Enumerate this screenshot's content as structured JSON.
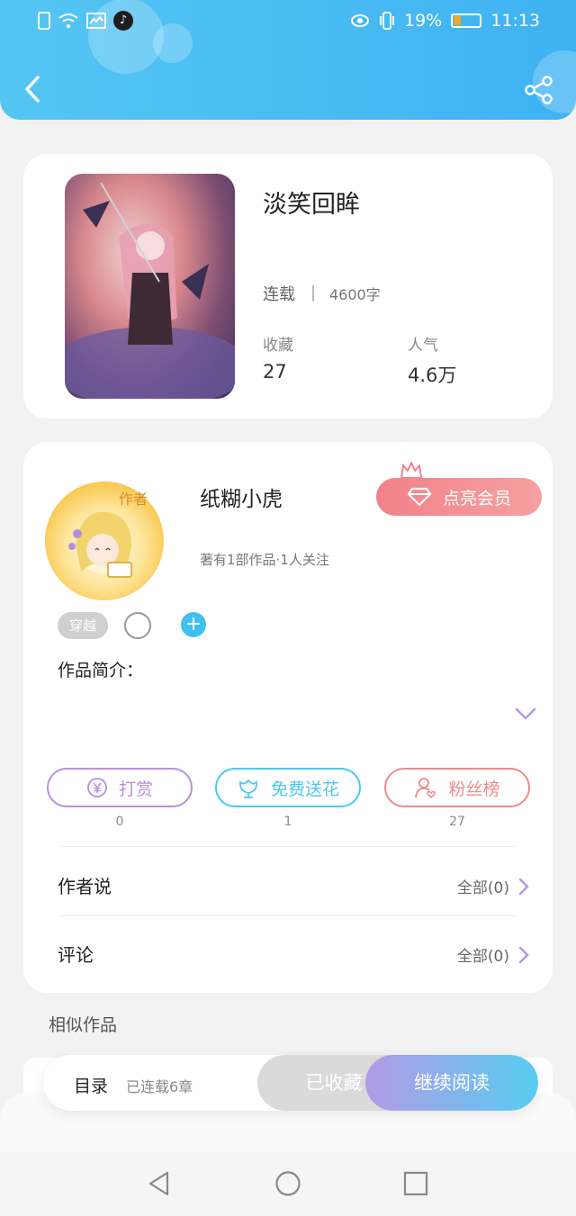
{
  "status_bar": {
    "left_icons": [
      "alert-icon",
      "wifi-icon",
      "signal-icon",
      "tiktok-icon"
    ],
    "battery_percent": "19%",
    "time": "11:13"
  },
  "book": {
    "title": "淡笑回眸",
    "status": "连载",
    "word_count": "4600字",
    "favorites_label": "收藏",
    "favorites_value": "27",
    "popularity_label": "人气",
    "popularity_value": "4.6万"
  },
  "author": {
    "avatar_badge": "作者",
    "name": "纸糊小虎",
    "subtitle": "著有1部作品·1人关注",
    "vip_button": "点亮会员",
    "tag": "穿越"
  },
  "intro": {
    "label": "作品简介："
  },
  "actions": [
    {
      "label": "打赏",
      "count": "0",
      "color": "#b98fe0",
      "icon": "yen-icon"
    },
    {
      "label": "免费送花",
      "count": "1",
      "color": "#4cc8ee",
      "icon": "flower-icon"
    },
    {
      "label": "粉丝榜",
      "count": "27",
      "color": "#ef8a8a",
      "icon": "fan-icon"
    }
  ],
  "author_says": {
    "label": "作者说",
    "count": "全部(0)"
  },
  "comments": {
    "label": "评论",
    "count": "全部(0)"
  },
  "similar": {
    "label": "相似作品"
  },
  "bottom_bar": {
    "toc_label": "目录",
    "toc_sub": "已连载6章",
    "favorited_label": "已收藏",
    "read_label": "继续阅读"
  },
  "colors": {
    "header": "#3fb2f2",
    "accent_purple": "#b39ae6",
    "vip_pink": "#f2818a"
  }
}
